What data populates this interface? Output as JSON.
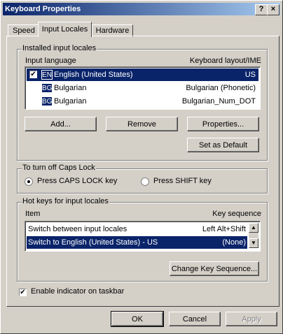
{
  "window": {
    "title": "Keyboard Properties",
    "help_glyph": "?",
    "close_glyph": "×"
  },
  "tabs": [
    {
      "label": "Speed"
    },
    {
      "label": "Input Locales"
    },
    {
      "label": "Hardware"
    }
  ],
  "installed": {
    "group_title": "Installed input locales",
    "col_language": "Input language",
    "col_layout": "Keyboard layout/IME",
    "rows": [
      {
        "checked": "✔",
        "badge": "EN",
        "language": "English (United States)",
        "layout": "US"
      },
      {
        "badge": "BG",
        "language": "Bulgarian",
        "layout": "Bulgarian (Phonetic)"
      },
      {
        "badge": "BG",
        "language": "Bulgarian",
        "layout": "Bulgarian_Num_DOT"
      }
    ],
    "buttons": {
      "add": "Add...",
      "remove": "Remove",
      "properties": "Properties...",
      "set_default": "Set as Default"
    }
  },
  "caps": {
    "group_title": "To turn off Caps Lock",
    "option1": "Press CAPS LOCK key",
    "option2": "Press SHIFT key",
    "selected": "option1"
  },
  "hotkeys": {
    "group_title": "Hot keys for input locales",
    "col_item": "Item",
    "col_sequence": "Key sequence",
    "rows": [
      {
        "item": "Switch between input locales",
        "sequence": "Left Alt+Shift"
      },
      {
        "item": "Switch to English (United States) - US",
        "sequence": "(None)"
      }
    ],
    "change_button": "Change Key Sequence..."
  },
  "indicator": {
    "label": "Enable indicator on taskbar",
    "checked": true,
    "check_glyph": "✔"
  },
  "footer": {
    "ok": "OK",
    "cancel": "Cancel",
    "apply": "Apply"
  }
}
